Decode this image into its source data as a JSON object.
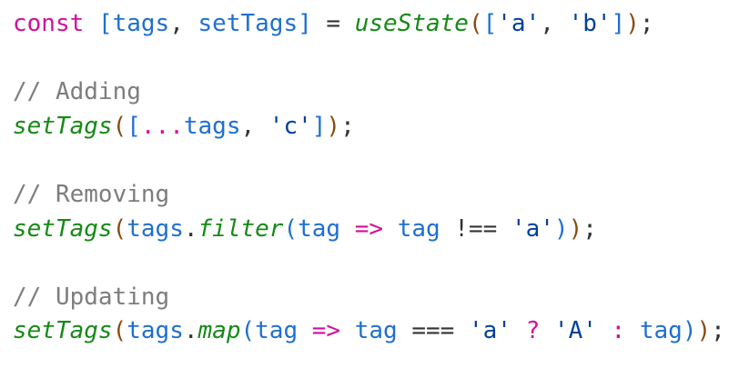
{
  "lines": [
    [
      {
        "t": "const",
        "c": "kw"
      },
      {
        "t": " ",
        "c": "plain"
      },
      {
        "t": "[",
        "c": "p3"
      },
      {
        "t": "tags",
        "c": "var"
      },
      {
        "t": ", ",
        "c": "plain"
      },
      {
        "t": "setTags",
        "c": "var"
      },
      {
        "t": "]",
        "c": "p3"
      },
      {
        "t": " = ",
        "c": "plain"
      },
      {
        "t": "useState",
        "c": "fn"
      },
      {
        "t": "(",
        "c": "p2"
      },
      {
        "t": "[",
        "c": "p3"
      },
      {
        "t": "'a'",
        "c": "str"
      },
      {
        "t": ", ",
        "c": "plain"
      },
      {
        "t": "'b'",
        "c": "str"
      },
      {
        "t": "]",
        "c": "p3"
      },
      {
        "t": ")",
        "c": "p2"
      },
      {
        "t": ";",
        "c": "plain"
      }
    ],
    [],
    [
      {
        "t": "// Adding",
        "c": "cm"
      }
    ],
    [
      {
        "t": "setTags",
        "c": "fn"
      },
      {
        "t": "(",
        "c": "p2"
      },
      {
        "t": "[",
        "c": "p3"
      },
      {
        "t": "...",
        "c": "kw"
      },
      {
        "t": "tags",
        "c": "var"
      },
      {
        "t": ", ",
        "c": "plain"
      },
      {
        "t": "'c'",
        "c": "str"
      },
      {
        "t": "]",
        "c": "p3"
      },
      {
        "t": ")",
        "c": "p2"
      },
      {
        "t": ";",
        "c": "plain"
      }
    ],
    [],
    [
      {
        "t": "// Removing",
        "c": "cm"
      }
    ],
    [
      {
        "t": "setTags",
        "c": "fn"
      },
      {
        "t": "(",
        "c": "p2"
      },
      {
        "t": "tags",
        "c": "var"
      },
      {
        "t": ".",
        "c": "plain"
      },
      {
        "t": "filter",
        "c": "fn"
      },
      {
        "t": "(",
        "c": "p3"
      },
      {
        "t": "tag",
        "c": "var"
      },
      {
        "t": " ",
        "c": "plain"
      },
      {
        "t": "=>",
        "c": "op"
      },
      {
        "t": " ",
        "c": "plain"
      },
      {
        "t": "tag",
        "c": "var"
      },
      {
        "t": " !== ",
        "c": "plain"
      },
      {
        "t": "'a'",
        "c": "str"
      },
      {
        "t": ")",
        "c": "p3"
      },
      {
        "t": ")",
        "c": "p2"
      },
      {
        "t": ";",
        "c": "plain"
      }
    ],
    [],
    [
      {
        "t": "// Updating",
        "c": "cm"
      }
    ],
    [
      {
        "t": "setTags",
        "c": "fn"
      },
      {
        "t": "(",
        "c": "p2"
      },
      {
        "t": "tags",
        "c": "var"
      },
      {
        "t": ".",
        "c": "plain"
      },
      {
        "t": "map",
        "c": "fn"
      },
      {
        "t": "(",
        "c": "p3"
      },
      {
        "t": "tag",
        "c": "var"
      },
      {
        "t": " ",
        "c": "plain"
      },
      {
        "t": "=>",
        "c": "op"
      },
      {
        "t": " ",
        "c": "plain"
      },
      {
        "t": "tag",
        "c": "var"
      },
      {
        "t": " === ",
        "c": "plain"
      },
      {
        "t": "'a'",
        "c": "str"
      },
      {
        "t": " ",
        "c": "plain"
      },
      {
        "t": "?",
        "c": "op"
      },
      {
        "t": " ",
        "c": "plain"
      },
      {
        "t": "'A'",
        "c": "str"
      },
      {
        "t": " ",
        "c": "plain"
      },
      {
        "t": ":",
        "c": "op"
      },
      {
        "t": " ",
        "c": "plain"
      },
      {
        "t": "tag",
        "c": "var"
      },
      {
        "t": ")",
        "c": "p3"
      },
      {
        "t": ")",
        "c": "p2"
      },
      {
        "t": ";",
        "c": "plain"
      }
    ]
  ],
  "colors": {
    "keyword": "#d10f9a",
    "variable": "#1f6fd1",
    "function": "#168a16",
    "string": "#003f9e",
    "comment": "#7d7d7d",
    "paren": "#8a4b11",
    "plain": "#333333",
    "background": "#ffffff"
  }
}
